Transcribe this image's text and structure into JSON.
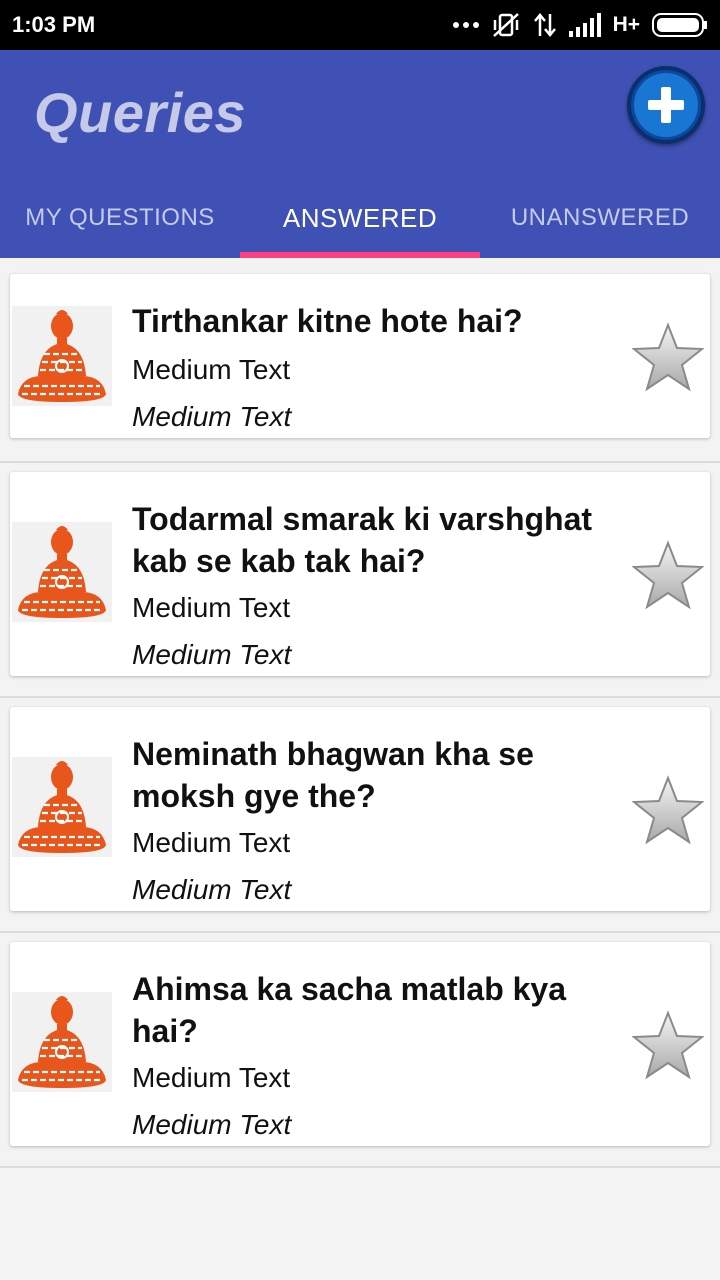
{
  "status_bar": {
    "time": "1:03 PM",
    "network": "H+"
  },
  "app_bar": {
    "title": "Queries",
    "fab_icon": "add-icon"
  },
  "tabs": [
    {
      "label": "MY QUESTIONS",
      "active": false
    },
    {
      "label": "ANSWERED",
      "active": true
    },
    {
      "label": "UNANSWERED",
      "active": false
    }
  ],
  "colors": {
    "primary": "#3f51b5",
    "accent": "#ff4081",
    "thumbnail": "#e8561c"
  },
  "questions": [
    {
      "title": "Tirthankar kitne hote hai?",
      "subtitle": "Medium Text",
      "detail": "Medium Text",
      "thumbnail_icon": "meditating-figure-icon",
      "star_icon": "star-icon"
    },
    {
      "title": "Todarmal smarak ki varshghat kab se kab tak hai?",
      "subtitle": "Medium Text",
      "detail": "Medium Text",
      "thumbnail_icon": "meditating-figure-icon",
      "star_icon": "star-icon"
    },
    {
      "title": "Neminath bhagwan kha se moksh gye the?",
      "subtitle": "Medium Text",
      "detail": "Medium Text",
      "thumbnail_icon": "meditating-figure-icon",
      "star_icon": "star-icon"
    },
    {
      "title": "Ahimsa ka sacha matlab kya hai?",
      "subtitle": "Medium Text",
      "detail": "Medium Text",
      "thumbnail_icon": "meditating-figure-icon",
      "star_icon": "star-icon"
    }
  ]
}
